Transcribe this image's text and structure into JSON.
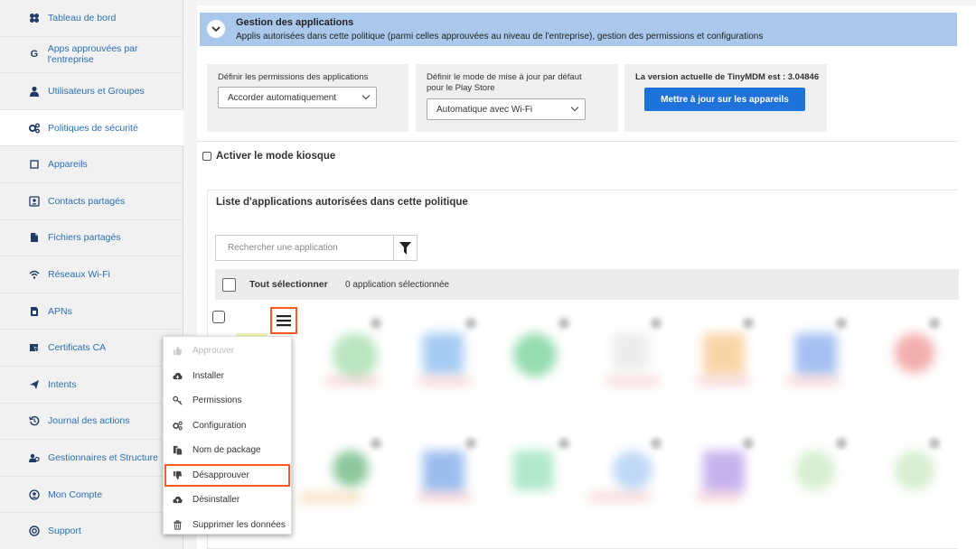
{
  "sidebar": {
    "items": [
      {
        "label": "Tableau de bord",
        "icon": "dashboard-icon"
      },
      {
        "label": "Apps approuvées par l'entreprise",
        "icon": "google-icon"
      },
      {
        "label": "Utilisateurs et Groupes",
        "icon": "user-icon"
      },
      {
        "label": "Politiques de sécurité",
        "icon": "gears-icon"
      },
      {
        "label": "Appareils",
        "icon": "device-icon"
      },
      {
        "label": "Contacts partagés",
        "icon": "contact-icon"
      },
      {
        "label": "Fichiers partagés",
        "icon": "file-icon"
      },
      {
        "label": "Réseaux Wi-Fi",
        "icon": "wifi-icon"
      },
      {
        "label": "APNs",
        "icon": "sim-icon"
      },
      {
        "label": "Certificats CA",
        "icon": "certificate-icon"
      },
      {
        "label": "Intents",
        "icon": "paper-plane-icon"
      },
      {
        "label": "Journal des actions",
        "icon": "history-icon"
      },
      {
        "label": "Gestionnaires et Structure",
        "icon": "managers-icon"
      },
      {
        "label": "Mon Compte",
        "icon": "account-icon"
      },
      {
        "label": "Support",
        "icon": "support-icon"
      }
    ]
  },
  "gestion": {
    "title": "Gestion des applications",
    "subtitle": "Applis autorisées dans cette politique (parmi celles approuvées au niveau de l'entreprise), gestion des permissions et configurations"
  },
  "config": {
    "permissions_label": "Définir les permissions des applications",
    "permissions_value": "Accorder automatiquement",
    "update_label": "Définir le mode de mise à jour par défaut pour le Play Store",
    "update_value": "Automatique avec Wi-Fi",
    "version_label": "La version actuelle de TinyMDM est : 3.04846",
    "update_button": "Mettre à jour sur les appareils"
  },
  "kiosk": {
    "label": "Activer le mode kiosque"
  },
  "app_list": {
    "title": "Liste d'applications autorisées dans cette politique",
    "search_placeholder": "Rechercher une application",
    "select_all": "Tout sélectionner",
    "selected_count": "0 application sélectionnée"
  },
  "context_menu": {
    "items": [
      {
        "label": "Approuver",
        "icon": "thumbs-up-icon",
        "state": "disabled"
      },
      {
        "label": "Installer",
        "icon": "cloud-download-icon",
        "state": "normal"
      },
      {
        "label": "Permissions",
        "icon": "key-icon",
        "state": "normal"
      },
      {
        "label": "Configuration",
        "icon": "gears-icon",
        "state": "normal"
      },
      {
        "label": "Nom de package",
        "icon": "copy-icon",
        "state": "normal"
      },
      {
        "label": "Désapprouver",
        "icon": "thumbs-down-icon",
        "state": "highlighted"
      },
      {
        "label": "Désinstaller",
        "icon": "cloud-upload-icon",
        "state": "normal"
      },
      {
        "label": "Supprimer les données",
        "icon": "trash-icon",
        "state": "normal"
      }
    ]
  },
  "colors": {
    "accent": "#1f72d9",
    "header_bg": "#aac8ec",
    "highlight": "#ff5a1f",
    "sidebar_link": "#2a6fb5"
  }
}
